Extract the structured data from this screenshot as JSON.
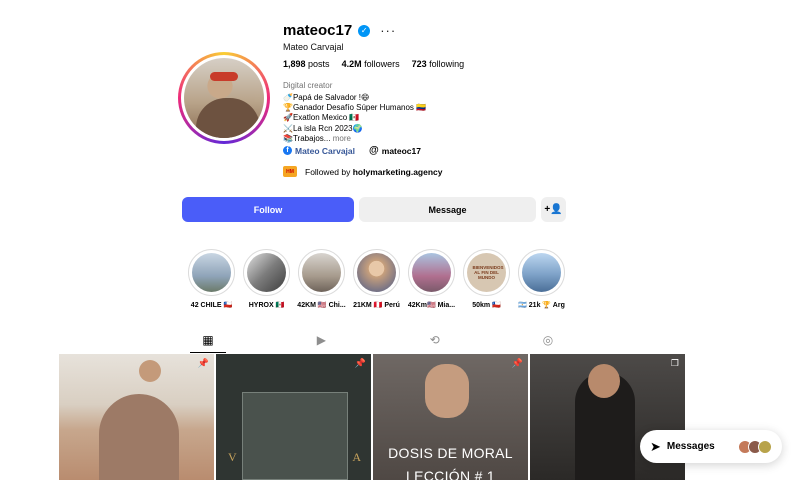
{
  "profile": {
    "username": "mateoc17",
    "full_name": "Mateo Carvajal",
    "posts_count": "1,898",
    "posts_label": "posts",
    "followers_count": "4.2M",
    "followers_label": "followers",
    "following_count": "723",
    "following_label": "following",
    "category": "Digital creator",
    "bio_lines": [
      "🍼Papá de Salvador !😄",
      "🏆Ganador Desafío Súper Humanos 🇨🇴",
      "🚀Exatlon Mexico 🇲🇽",
      "⚔️La isla Rcn 2023🌍",
      "📚Trabajos..."
    ],
    "bio_more": "more",
    "facebook_link": "Mateo Carvajal",
    "threads_link": "mateoc17",
    "followed_by_prefix": "Followed by",
    "followed_by_user": "holymarketing.agency",
    "followed_logo": "HM"
  },
  "actions": {
    "follow": "Follow",
    "message": "Message",
    "suggest_icon": "add-person-icon"
  },
  "highlights": [
    {
      "label": "42 CHILE 🇨🇱",
      "color": "#8ea3b8"
    },
    {
      "label": "HYROX 🇲🇽",
      "color": "#7c7c7c"
    },
    {
      "label": "42KM 🇺🇸 Chi...",
      "color": "#a69a8c"
    },
    {
      "label": "21KM 🇵🇪 Perú",
      "color": "#c8a07c"
    },
    {
      "label": "42Km🇺🇸 Mia...",
      "color": "#b06f8f"
    },
    {
      "label": "50km 🇨🇱",
      "color": "#d7c7b2"
    },
    {
      "label": "🇦🇷 21k 🏆 Arg",
      "color": "#7ea2c8"
    }
  ],
  "highlight_50km_text": "BIENVENIDOS AL FIN DEL MUNDO",
  "tabs": [
    {
      "name": "posts",
      "icon": "▦"
    },
    {
      "name": "reels",
      "icon": "▶"
    },
    {
      "name": "reposts",
      "icon": "⟲"
    },
    {
      "name": "tagged",
      "icon": "◎"
    }
  ],
  "posts": {
    "tile2_text_left": "V",
    "tile2_text_right": "A",
    "tile3_caption_line1": "DOSIS DE MORAL",
    "tile3_caption_line2": "LECCIÓN # 1"
  },
  "messages_label": "Messages",
  "colors": {
    "follow_button": "#4a5df9",
    "verified": "#0095f6"
  }
}
